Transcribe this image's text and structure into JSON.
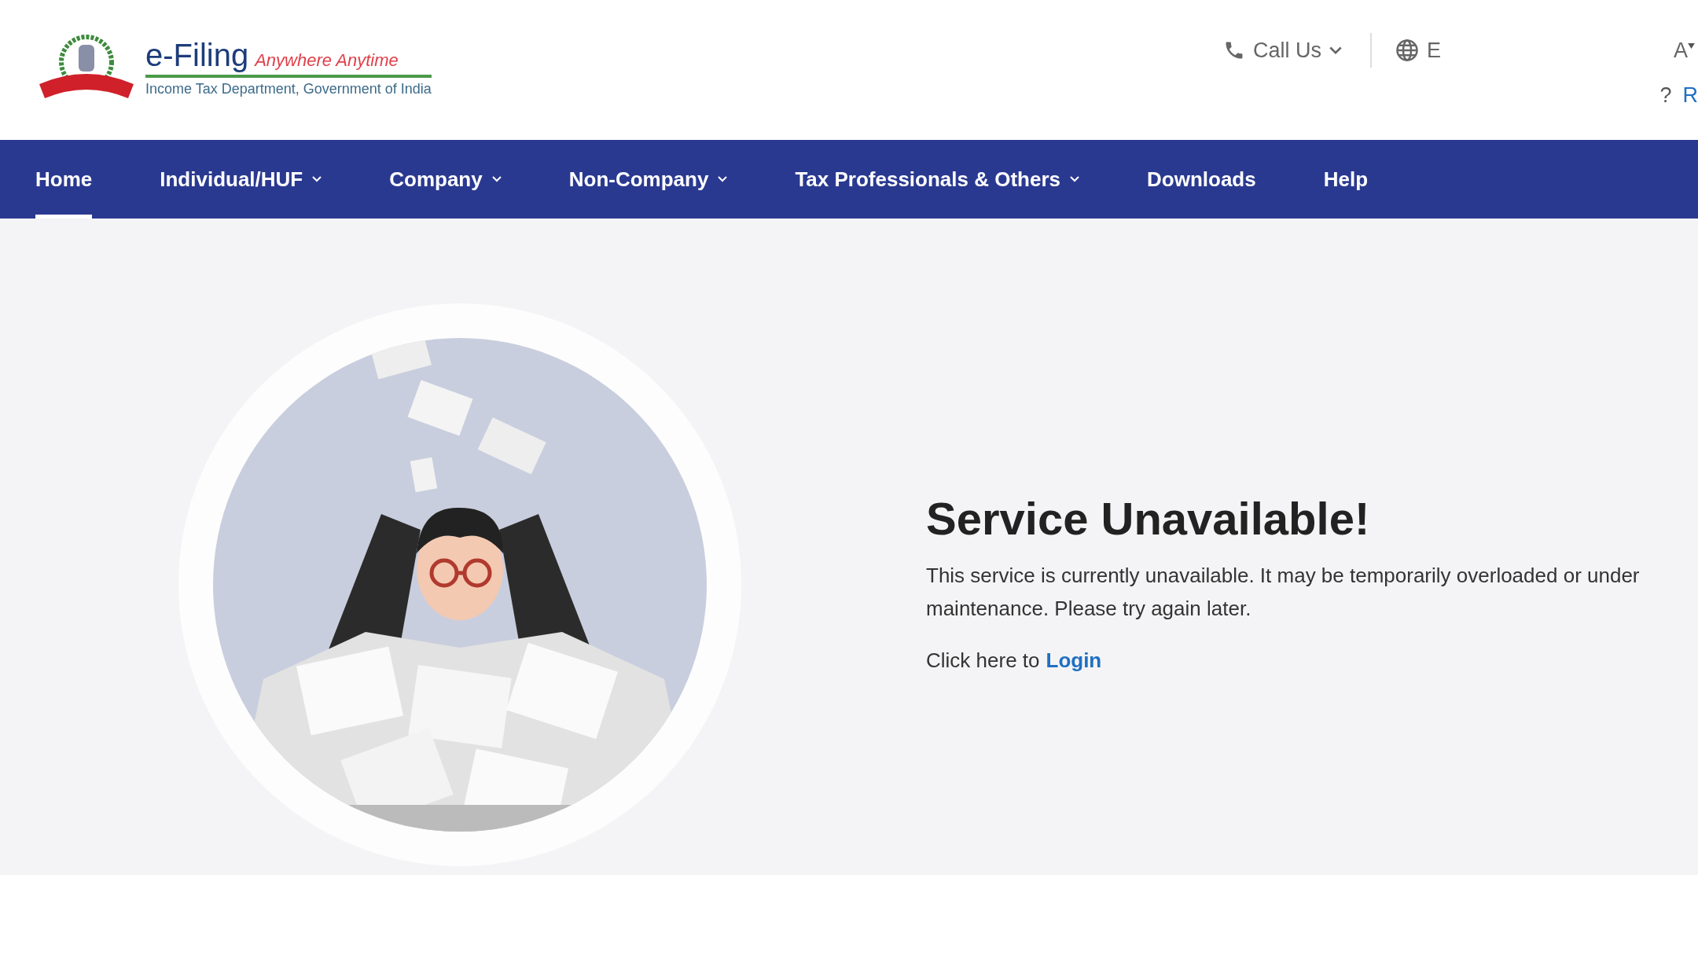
{
  "header": {
    "logo": {
      "title": "e-Filing",
      "tagline": "Anywhere Anytime",
      "subtitle": "Income Tax Department, Government of India"
    },
    "call_us": "Call Us",
    "language": "E",
    "font_size": "A",
    "help_mark": "?",
    "register_link": "R"
  },
  "nav": [
    {
      "label": "Home",
      "selected": true,
      "dropdown": false
    },
    {
      "label": "Individual/HUF",
      "selected": false,
      "dropdown": true
    },
    {
      "label": "Company",
      "selected": false,
      "dropdown": true
    },
    {
      "label": "Non-Company",
      "selected": false,
      "dropdown": true
    },
    {
      "label": "Tax Professionals & Others",
      "selected": false,
      "dropdown": true
    },
    {
      "label": "Downloads",
      "selected": false,
      "dropdown": false
    },
    {
      "label": "Help",
      "selected": false,
      "dropdown": false
    }
  ],
  "message": {
    "title": "Service Unavailable!",
    "body": "This service is currently unavailable. It may be temporarily overloaded or under maintenance. Please try again later.",
    "login_prompt": "Click here to",
    "login_link": "Login"
  }
}
